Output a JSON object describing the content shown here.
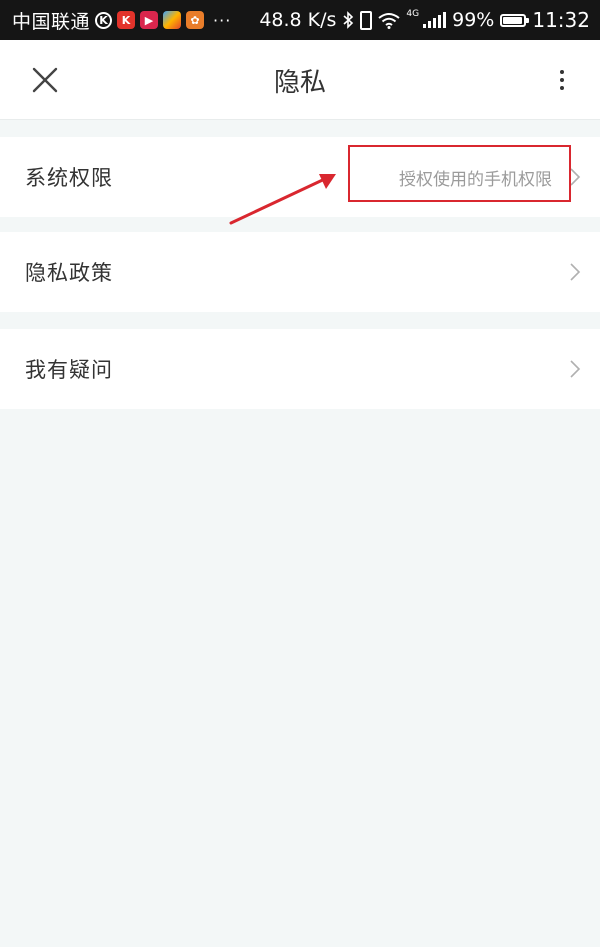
{
  "status_bar": {
    "carrier": "中国联通",
    "overflow": "···",
    "speed": "48.8 K/s",
    "network": "4G",
    "battery": "99%",
    "time": "11:32",
    "app_icons": [
      "k-circle-icon",
      "kugou-app-icon",
      "video-app-icon",
      "tencent-app-icon",
      "uc-browser-icon"
    ]
  },
  "header": {
    "title": "隐私",
    "close_icon": "close-icon",
    "menu_icon": "more-vertical-icon"
  },
  "rows": [
    {
      "label": "系统权限",
      "value": "授权使用的手机权限"
    },
    {
      "label": "隐私政策",
      "value": ""
    },
    {
      "label": "我有疑问",
      "value": ""
    }
  ],
  "colors": {
    "status_bar_bg": "#151515",
    "page_bg": "#f3f7f7",
    "annotation_red": "#d9272f",
    "text_primary": "#333333",
    "text_secondary": "#9b9b9b"
  }
}
